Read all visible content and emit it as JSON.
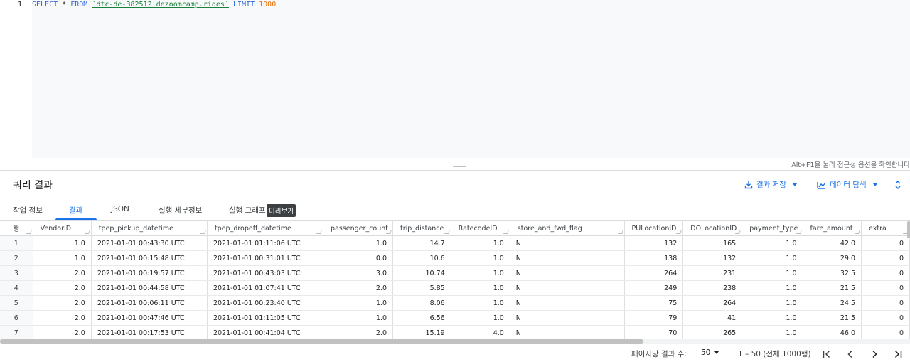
{
  "editor": {
    "line_number": "1",
    "kw_select": "SELECT",
    "star": " * ",
    "kw_from": "FROM",
    "table_ref": "`dtc-de-382512.dezoomcamp.rides`",
    "kw_limit": "LIMIT",
    "limit_value": "1000",
    "a11y_hint": "Alt+F1을 눌러 접근성 옵션을 확인합니다"
  },
  "results": {
    "title": "쿼리 결과",
    "save_label": "결과 저장",
    "explore_label": "데이터 탐색",
    "icons": {
      "save": "download-icon",
      "explore": "chart-icon",
      "expand": "unfold-icon"
    }
  },
  "tabs": [
    {
      "label": "작업 정보"
    },
    {
      "label": "결과"
    },
    {
      "label": "JSON"
    },
    {
      "label": "실행 세부정보"
    },
    {
      "label": "실행 그래프"
    }
  ],
  "preview_badge": "미리보기",
  "accent_color": "#1a73e8",
  "table": {
    "columns": [
      "행",
      "VendorID",
      "tpep_pickup_datetime",
      "tpep_dropoff_datetime",
      "passenger_count",
      "trip_distance",
      "RatecodeID",
      "store_and_fwd_flag",
      "PULocationID",
      "DOLocationID",
      "payment_type",
      "fare_amount",
      "extra"
    ],
    "rows": [
      [
        "1",
        "1.0",
        "2021-01-01 00:43:30 UTC",
        "2021-01-01 01:11:06 UTC",
        "1.0",
        "14.7",
        "1.0",
        "N",
        "132",
        "165",
        "1.0",
        "42.0",
        "0"
      ],
      [
        "2",
        "1.0",
        "2021-01-01 00:15:48 UTC",
        "2021-01-01 00:31:01 UTC",
        "0.0",
        "10.6",
        "1.0",
        "N",
        "138",
        "132",
        "1.0",
        "29.0",
        "0"
      ],
      [
        "3",
        "2.0",
        "2021-01-01 00:19:57 UTC",
        "2021-01-01 00:43:03 UTC",
        "3.0",
        "10.74",
        "1.0",
        "N",
        "264",
        "231",
        "1.0",
        "32.5",
        "0"
      ],
      [
        "4",
        "2.0",
        "2021-01-01 00:44:58 UTC",
        "2021-01-01 01:07:41 UTC",
        "2.0",
        "5.85",
        "1.0",
        "N",
        "249",
        "238",
        "1.0",
        "21.5",
        "0"
      ],
      [
        "5",
        "2.0",
        "2021-01-01 00:06:11 UTC",
        "2021-01-01 00:23:40 UTC",
        "1.0",
        "8.06",
        "1.0",
        "N",
        "75",
        "264",
        "1.0",
        "24.5",
        "0"
      ],
      [
        "6",
        "2.0",
        "2021-01-01 00:47:46 UTC",
        "2021-01-01 01:11:05 UTC",
        "1.0",
        "6.56",
        "1.0",
        "N",
        "79",
        "41",
        "1.0",
        "21.5",
        "0"
      ],
      [
        "7",
        "2.0",
        "2021-01-01 00:17:53 UTC",
        "2021-01-01 00:41:04 UTC",
        "2.0",
        "15.19",
        "4.0",
        "N",
        "70",
        "265",
        "1.0",
        "46.0",
        "0"
      ]
    ]
  },
  "pagination": {
    "per_page_label": "페이지당 결과 수:",
    "per_page_value": "50",
    "range": "1 – 50 (전체 1000행)",
    "icons": [
      "first-page-icon",
      "prev-page-icon",
      "next-page-icon",
      "last-page-icon"
    ]
  }
}
